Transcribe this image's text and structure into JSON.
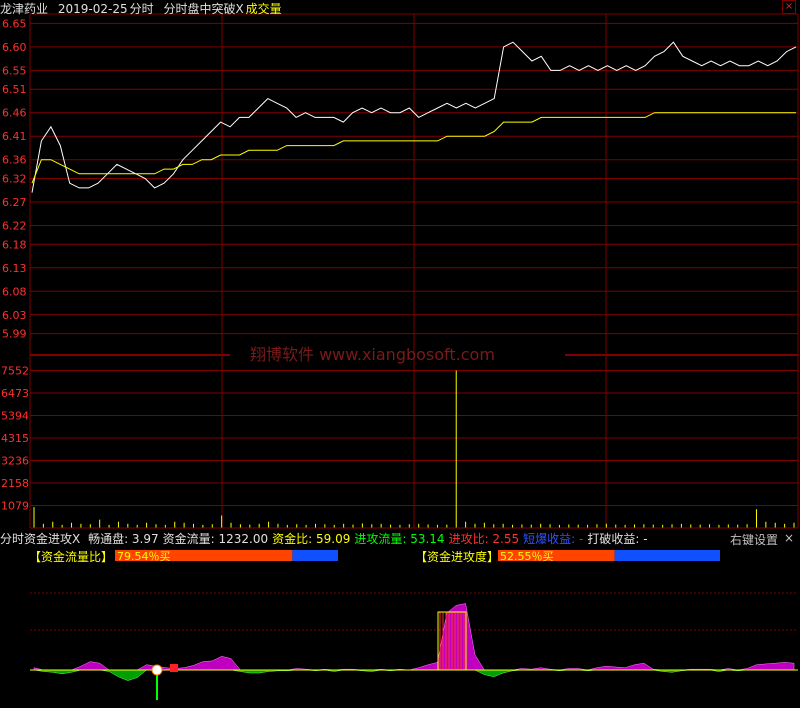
{
  "header": {
    "stock_name": "龙津药业",
    "date": "2019-02-25",
    "mode": "分时",
    "indicator": "分时盘中突破X",
    "volume_label": "成交量"
  },
  "watermark": "翔博软件 www.xiangbosoft.com",
  "price_axis": [
    "6.65",
    "6.60",
    "6.55",
    "6.51",
    "6.46",
    "6.41",
    "6.36",
    "6.32",
    "6.27",
    "6.22",
    "6.18",
    "6.13",
    "6.08",
    "6.03",
    "5.99"
  ],
  "volume_axis": [
    "7552",
    "6473",
    "5394",
    "4315",
    "3236",
    "2158",
    "1079"
  ],
  "indicator_bar": {
    "name": "分时资金进攻X",
    "items": [
      {
        "label": "畅通盘:",
        "value": "3.97",
        "color": "#e0e0e0"
      },
      {
        "label": "资金流量:",
        "value": "1232.00",
        "color": "#e0e0e0"
      },
      {
        "label": "资金比:",
        "value": "59.09",
        "color": "#ffff00"
      },
      {
        "label": "进攻流量:",
        "value": "53.14",
        "color": "#00ff00"
      },
      {
        "label": "进攻比:",
        "value": "2.55",
        "color": "#ff3030"
      },
      {
        "label": "短爆收益:",
        "value": "-",
        "color": "#3050ff"
      },
      {
        "label": "打破收益:",
        "value": "-",
        "color": "#e0e0e0"
      }
    ],
    "right_settings": "右键设置",
    "close": "×"
  },
  "flow_bar_1": {
    "label": "【资金流量比】",
    "text": "79.54％买",
    "fill": 0.7954
  },
  "flow_bar_2": {
    "label": "【资金进攻度】",
    "text": "52.55％买",
    "fill": 0.5255
  },
  "colors": {
    "grid": "#800000",
    "price_text": "#ff3030",
    "price_line": "#ffffff",
    "avg_line": "#ffff00",
    "volume": "#ffff00",
    "buy": "#ff4400",
    "sell": "#1050ff",
    "magenta": "#c000c0",
    "green": "#00a000"
  },
  "chart_data": {
    "type": "line",
    "price_series": [
      6.29,
      6.4,
      6.43,
      6.39,
      6.31,
      6.3,
      6.3,
      6.31,
      6.33,
      6.35,
      6.34,
      6.33,
      6.32,
      6.3,
      6.31,
      6.33,
      6.36,
      6.38,
      6.4,
      6.42,
      6.44,
      6.43,
      6.45,
      6.45,
      6.47,
      6.49,
      6.48,
      6.47,
      6.45,
      6.46,
      6.45,
      6.45,
      6.45,
      6.44,
      6.46,
      6.47,
      6.46,
      6.47,
      6.46,
      6.46,
      6.47,
      6.45,
      6.46,
      6.47,
      6.48,
      6.47,
      6.48,
      6.47,
      6.48,
      6.49,
      6.6,
      6.61,
      6.59,
      6.57,
      6.58,
      6.55,
      6.55,
      6.56,
      6.55,
      6.56,
      6.55,
      6.56,
      6.55,
      6.56,
      6.55,
      6.56,
      6.58,
      6.59,
      6.61,
      6.58,
      6.57,
      6.56,
      6.57,
      6.56,
      6.57,
      6.56,
      6.56,
      6.57,
      6.56,
      6.57,
      6.59,
      6.6
    ],
    "avg_series": [
      6.31,
      6.36,
      6.36,
      6.35,
      6.34,
      6.33,
      6.33,
      6.33,
      6.33,
      6.33,
      6.33,
      6.33,
      6.33,
      6.33,
      6.34,
      6.34,
      6.35,
      6.35,
      6.36,
      6.36,
      6.37,
      6.37,
      6.37,
      6.38,
      6.38,
      6.38,
      6.38,
      6.39,
      6.39,
      6.39,
      6.39,
      6.39,
      6.39,
      6.4,
      6.4,
      6.4,
      6.4,
      6.4,
      6.4,
      6.4,
      6.4,
      6.4,
      6.4,
      6.4,
      6.41,
      6.41,
      6.41,
      6.41,
      6.41,
      6.42,
      6.44,
      6.44,
      6.44,
      6.44,
      6.45,
      6.45,
      6.45,
      6.45,
      6.45,
      6.45,
      6.45,
      6.45,
      6.45,
      6.45,
      6.45,
      6.45,
      6.46,
      6.46,
      6.46,
      6.46,
      6.46,
      6.46,
      6.46,
      6.46,
      6.46,
      6.46,
      6.46,
      6.46,
      6.46,
      6.46,
      6.46,
      6.46
    ],
    "price_ylim": [
      5.97,
      6.67
    ],
    "volume_ylim": [
      0,
      8200
    ],
    "volume": [
      1000,
      200,
      300,
      150,
      250,
      200,
      180,
      400,
      150,
      300,
      200,
      150,
      250,
      180,
      150,
      300,
      250,
      200,
      150,
      180,
      600,
      250,
      180,
      160,
      200,
      300,
      200,
      150,
      180,
      150,
      200,
      180,
      150,
      200,
      160,
      220,
      180,
      200,
      160,
      150,
      180,
      200,
      170,
      150,
      160,
      7552,
      300,
      200,
      250,
      180,
      200,
      150,
      170,
      160,
      200,
      180,
      150,
      170,
      160,
      150,
      180,
      200,
      160,
      150,
      170,
      180,
      160,
      150,
      180,
      200,
      170,
      160,
      180,
      150,
      170,
      160,
      180,
      900,
      300,
      250,
      200,
      250
    ],
    "flow_series": [
      6,
      -4,
      -6,
      -10,
      -6,
      10,
      22,
      18,
      -4,
      -18,
      -28,
      -20,
      14,
      10,
      6,
      4,
      6,
      12,
      22,
      24,
      36,
      30,
      -4,
      -8,
      -8,
      -4,
      -2,
      -2,
      4,
      2,
      -2,
      2,
      -4,
      2,
      2,
      -2,
      -4,
      2,
      -2,
      2,
      0,
      6,
      14,
      20,
      150,
      170,
      175,
      40,
      -12,
      -18,
      -8,
      -2,
      4,
      2,
      6,
      2,
      -2,
      4,
      4,
      -2,
      6,
      10,
      8,
      6,
      14,
      18,
      2,
      -4,
      -6,
      -2,
      2,
      2,
      2,
      -4,
      4,
      -2,
      4,
      14,
      16,
      18,
      20,
      18
    ]
  }
}
